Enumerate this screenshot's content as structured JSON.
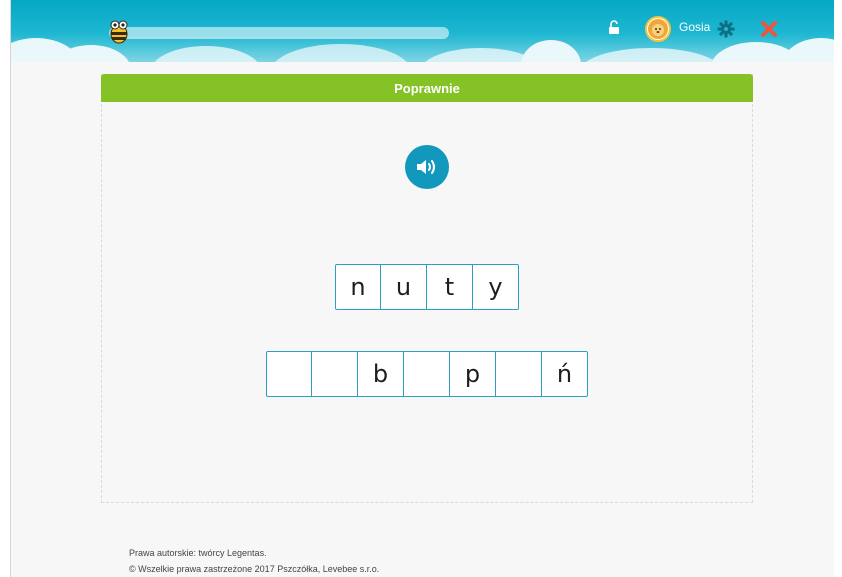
{
  "header": {
    "username": "Gosia",
    "progress": 0,
    "icons": {
      "mascot": "bee-icon",
      "lock": "unlock-icon",
      "avatar": "lion-avatar-icon",
      "settings": "gear-icon",
      "close": "close-icon"
    },
    "colors": {
      "sky": "#05a7c6",
      "close": "#e9573f",
      "gear": "#0d6f86"
    }
  },
  "panel": {
    "status": "Poprawnie",
    "status_color": "#84c225",
    "sound_icon": "speaker-icon",
    "word_letters": [
      "n",
      "u",
      "t",
      "y"
    ],
    "answer_letters": [
      "",
      "",
      "b",
      "",
      "p",
      "",
      "ń"
    ]
  },
  "footer": {
    "line1": "Prawa autorskie: twórcy Legentas.",
    "line2": "© Wszelkie prawa zastrzeżone 2017 Pszczółka, Levebee s.r.o."
  }
}
